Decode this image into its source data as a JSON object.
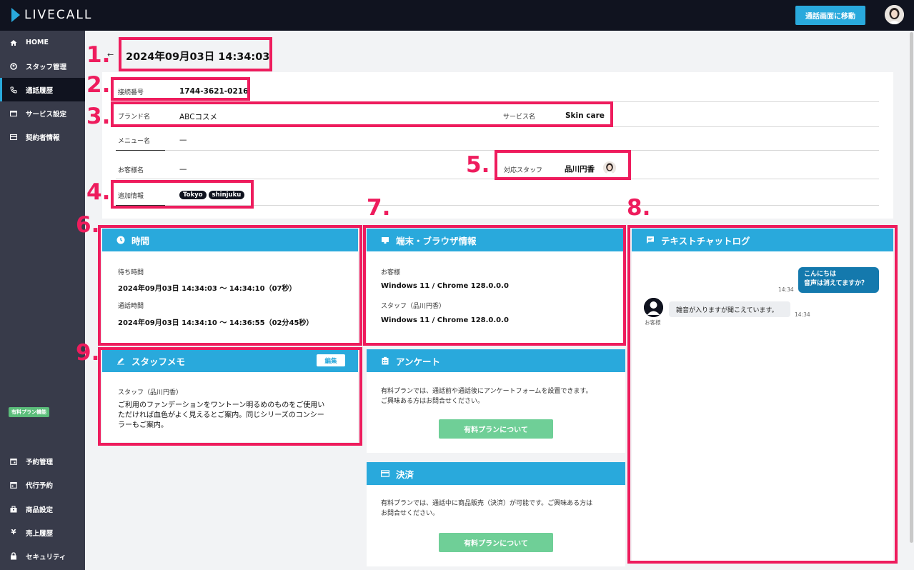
{
  "header": {
    "logo": "LIVECALL",
    "call_screen_button": "通話画面に移動"
  },
  "sidebar": {
    "items": [
      {
        "label": "HOME",
        "icon": "home-icon"
      },
      {
        "label": "スタッフ管理",
        "icon": "staff-icon"
      },
      {
        "label": "通話履歴",
        "icon": "phone-icon"
      },
      {
        "label": "サービス設定",
        "icon": "service-icon"
      },
      {
        "label": "契約者情報",
        "icon": "card-icon"
      }
    ],
    "plan_badge": "有料プラン機能",
    "plan_items": [
      {
        "label": "予約管理",
        "icon": "calendar-icon"
      },
      {
        "label": "代行予約",
        "icon": "calendar-icon"
      },
      {
        "label": "商品設定",
        "icon": "box-icon"
      },
      {
        "label": "売上履歴",
        "icon": "yen-icon"
      },
      {
        "label": "セキュリティ",
        "icon": "lock-icon"
      }
    ]
  },
  "page": {
    "title": "2024年09月03日 14:34:03"
  },
  "details": {
    "connection_label": "接続番号",
    "connection_value": "1744-3621-0216",
    "brand_label": "ブランド名",
    "brand_value": "ABCコスメ",
    "service_label": "サービス名",
    "service_value": "Skin care",
    "menu_label": "メニュー名",
    "menu_value": "—",
    "customer_label": "お客様名",
    "customer_value": "—",
    "staff_label": "対応スタッフ",
    "staff_value": "品川円香",
    "extra_label": "追加情報",
    "tags": [
      "Tokyo",
      "shinjuku"
    ]
  },
  "time_panel": {
    "title": "時間",
    "wait_label": "待ち時間",
    "wait_value": "2024年09月03日 14:34:03 〜 14:34:10（07秒）",
    "call_label": "通話時間",
    "call_value": "2024年09月03日 14:34:10 〜 14:36:55（02分45秒）"
  },
  "device_panel": {
    "title": "端末・ブラウザ情報",
    "customer_label": "お客様",
    "customer_value": "Windows 11 / Chrome 128.0.0.0",
    "staff_label": "スタッフ（品川円香）",
    "staff_value": "Windows 11 / Chrome 128.0.0.0"
  },
  "memo_panel": {
    "title": "スタッフメモ",
    "edit_button": "編集",
    "author": "スタッフ（品川円香）",
    "line1": "ご利用のファンデーションをワントーン明るめのものをご使用い",
    "line2": "ただければ血色がよく見えるとご案内。同じシリーズのコンシー",
    "line3": "ラーもご案内。"
  },
  "survey_panel": {
    "title": "アンケート",
    "line1": "有料プランでは、通話前や通話後にアンケートフォームを設置できます。",
    "line2": "ご興味ある方はお問合せください。",
    "button": "有料プランについて"
  },
  "payment_panel": {
    "title": "決済",
    "line1": "有料プランでは、通話中に商品販売（決済）が可能です。ご興味ある方は",
    "line2": "お問合せください。",
    "button": "有料プランについて"
  },
  "chat_panel": {
    "title": "テキストチャットログ",
    "staff_msg_line1": "こんにちは",
    "staff_msg_line2": "音声は消えてますか？",
    "staff_time": "14:34",
    "customer_msg": "雑音が入りますが聞こえています。",
    "customer_time": "14:34",
    "customer_name": "お客様"
  },
  "annotations": [
    "1.",
    "2.",
    "3.",
    "4.",
    "5.",
    "6.",
    "7.",
    "8.",
    "9."
  ],
  "colors": {
    "accent": "#29a9dc",
    "highlight": "#ee1c5d",
    "sidebar": "#383b4a",
    "topbar": "#10131f",
    "green": "#6fcf97"
  }
}
